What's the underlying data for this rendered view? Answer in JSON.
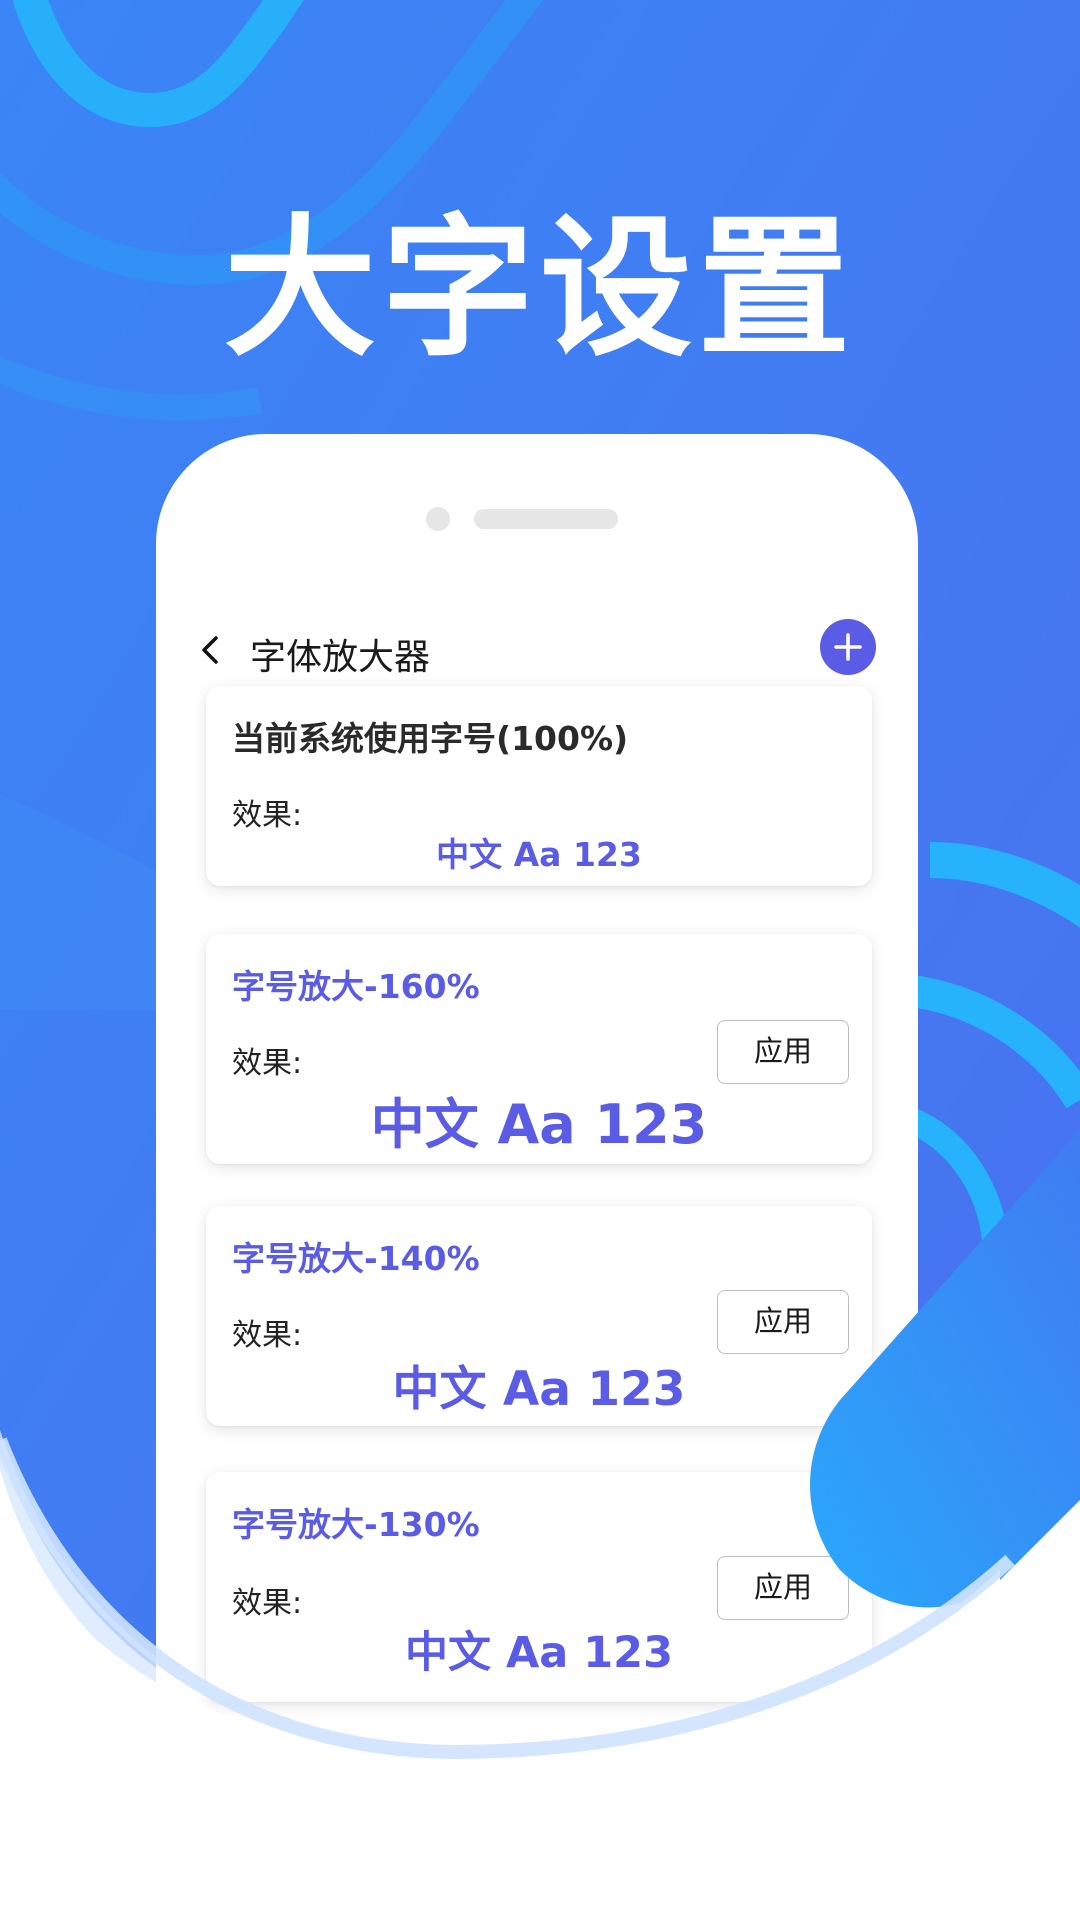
{
  "hero": {
    "title": "大字设置"
  },
  "header": {
    "title": "字体放大器"
  },
  "current": {
    "title": "当前系统使用字号(100%)",
    "effect_label": "效果:",
    "sample": "中文 Aa 123"
  },
  "options": [
    {
      "title": "字号放大-160%",
      "effect_label": "效果:",
      "sample": "中文 Aa 123",
      "apply_label": "应用"
    },
    {
      "title": "字号放大-140%",
      "effect_label": "效果:",
      "sample": "中文 Aa 123",
      "apply_label": "应用"
    },
    {
      "title": "字号放大-130%",
      "effect_label": "效果:",
      "sample": "中文 Aa 123",
      "apply_label": "应用"
    }
  ],
  "colors": {
    "accent": "#5a5ce6",
    "background_blue": "#4a7cf0",
    "ring_blue": "#2ab4fb"
  },
  "icons": {
    "back": "chevron-left-icon",
    "add": "plus-circle-icon"
  }
}
